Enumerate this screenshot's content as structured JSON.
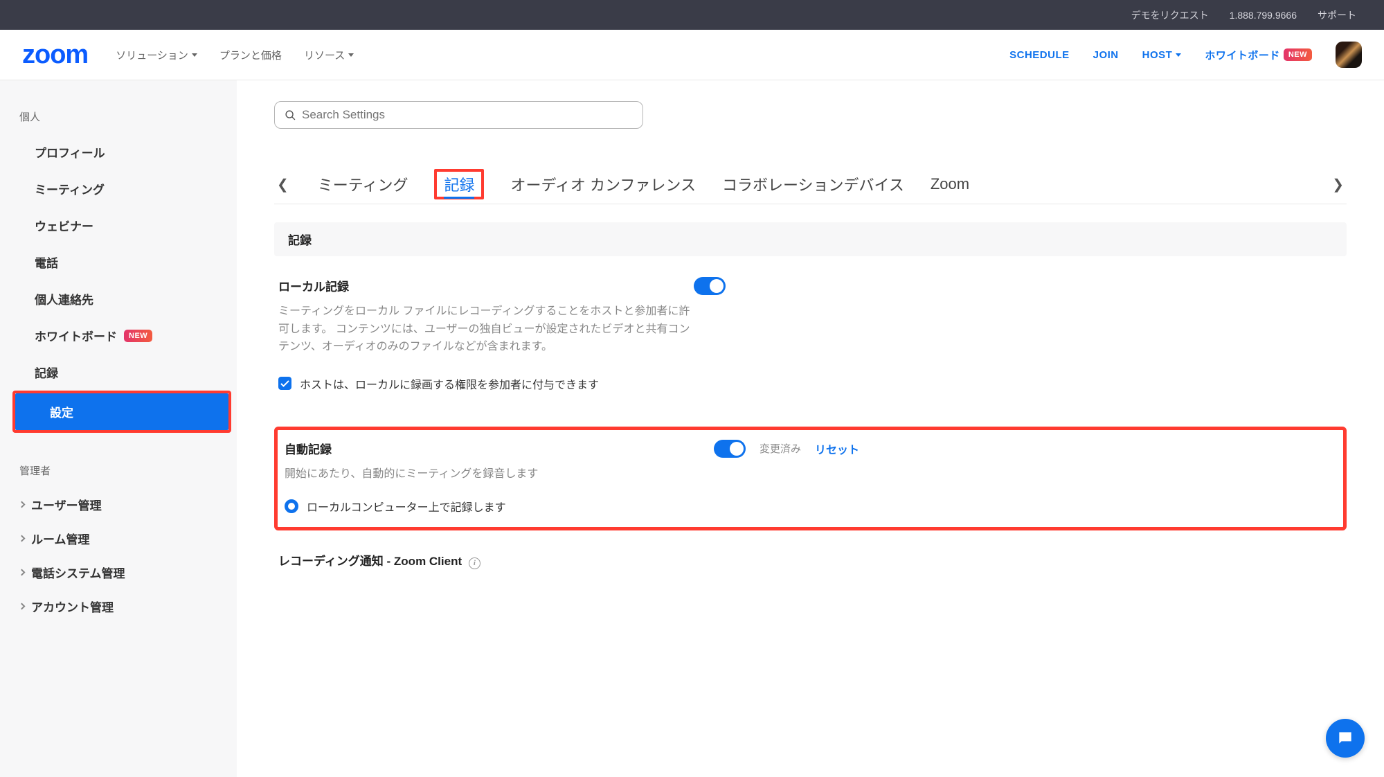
{
  "topbar": {
    "demo": "デモをリクエスト",
    "phone": "1.888.799.9666",
    "support": "サポート"
  },
  "header": {
    "logo": "zoom",
    "nav": {
      "solutions": "ソリューション",
      "plans": "プランと価格",
      "resources": "リソース"
    },
    "right": {
      "schedule": "SCHEDULE",
      "join": "JOIN",
      "host": "HOST",
      "whiteboard": "ホワイトボード",
      "new_badge": "NEW"
    }
  },
  "sidebar": {
    "personal_label": "個人",
    "items": {
      "profile": "プロフィール",
      "meeting": "ミーティング",
      "webinar": "ウェビナー",
      "phone": "電話",
      "contacts": "個人連絡先",
      "whiteboard": "ホワイトボード",
      "whiteboard_badge": "NEW",
      "recording": "記録",
      "settings": "設定"
    },
    "admin_label": "管理者",
    "admin_items": {
      "user_mgmt": "ユーザー管理",
      "room_mgmt": "ルーム管理",
      "phone_mgmt": "電話システム管理",
      "account_mgmt": "アカウント管理"
    }
  },
  "main": {
    "search_placeholder": "Search Settings",
    "tabs": {
      "meeting": "ミーティング",
      "recording": "記録",
      "audio": "オーディオ カンファレンス",
      "collab": "コラボレーションデバイス",
      "zoom": "Zoom"
    },
    "section_header": "記録",
    "local_recording": {
      "title": "ローカル記録",
      "desc": "ミーティングをローカル ファイルにレコーディングすることをホストと参加者に許可します。 コンテンツには、ユーザーの独自ビューが設定されたビデオと共有コンテンツ、オーディオのみのファイルなどが含まれます。",
      "checkbox": "ホストは、ローカルに録画する権限を参加者に付与できます"
    },
    "auto_recording": {
      "title": "自動記録",
      "desc": "開始にあたり、自動的にミーティングを録音します",
      "radio": "ローカルコンピューター上で記録します",
      "status": "変更済み",
      "reset": "リセット"
    },
    "rec_notify": {
      "title": "レコーディング通知 - Zoom Client"
    }
  }
}
